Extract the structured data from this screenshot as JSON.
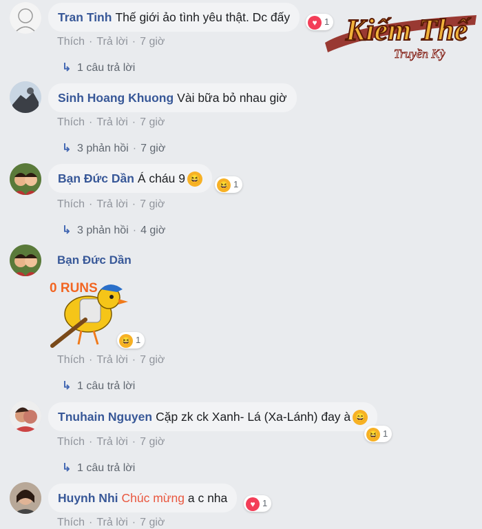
{
  "logo": {
    "title": "Kiếm Thế",
    "subtitle": "Truyền Kỳ"
  },
  "comments": [
    {
      "author": "Tran Tinh",
      "text": "Thế giới ảo tình yêu thật. Dc đấy",
      "like": "Thích",
      "reply": "Trả lời",
      "time": "7 giờ",
      "reaction": {
        "icon": "heart-icon",
        "count": "1"
      },
      "replies": "1 câu trả lời"
    },
    {
      "author": "Sinh Hoang Khuong",
      "text": "Vài bữa bỏ nhau giờ",
      "like": "Thích",
      "reply": "Trả lời",
      "time": "7 giờ",
      "replies": "3 phản hồi",
      "replies_time": "7 giờ"
    },
    {
      "author": "Bạn Đức Dần",
      "text": "Á cháu 9",
      "like": "Thích",
      "reply": "Trả lời",
      "time": "7 giờ",
      "reaction": {
        "icon": "haha-icon",
        "count": "1"
      },
      "replies": "3 phản hồi",
      "replies_time": "4 giờ"
    },
    {
      "author": "Bạn Đức Dần",
      "sticker_text": "0 RUNS",
      "like": "Thích",
      "reply": "Trả lời",
      "time": "7 giờ",
      "reaction": {
        "icon": "haha-icon",
        "count": "1"
      },
      "replies": "1 câu trả lời"
    },
    {
      "author": "Tnuhain Nguyen",
      "text": "Cặp zk ck Xanh- Lá (Xa-Lánh) đay à",
      "like": "Thích",
      "reply": "Trả lời",
      "time": "7 giờ",
      "reaction": {
        "icon": "haha-icon",
        "count": "1"
      },
      "replies": "1 câu trả lời"
    },
    {
      "author": "Huynh Nhi",
      "text_highlight": "Chúc mừng",
      "text": "a c nha",
      "like": "Thích",
      "reply": "Trả lời",
      "time": "7 giờ",
      "reaction": {
        "icon": "heart-icon",
        "count": "1"
      }
    }
  ],
  "colors": {
    "author": "#385898",
    "link": "#4267b2",
    "meta": "#90949c",
    "highlight": "#e9573f",
    "bubble": "#f2f3f5"
  }
}
